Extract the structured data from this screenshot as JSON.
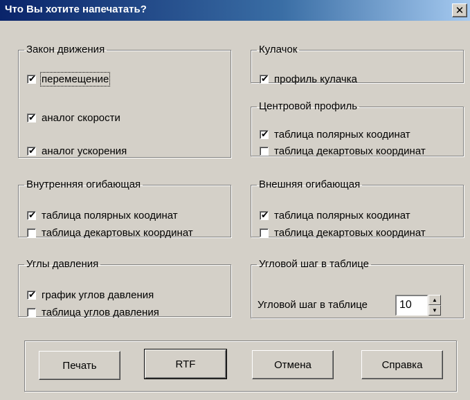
{
  "window": {
    "title": "Что Вы хотите напечатать?",
    "close_label": "✕"
  },
  "motion": {
    "legend": "Закон движения",
    "items": [
      {
        "label": "перемещение",
        "checked": true
      },
      {
        "label": "аналог скорости",
        "checked": true
      },
      {
        "label": "аналог ускорения",
        "checked": true
      }
    ]
  },
  "cam": {
    "legend": "Кулачок",
    "items": [
      {
        "label": "профиль кулачка",
        "checked": true
      }
    ]
  },
  "center_profile": {
    "legend": "Центровой профиль",
    "items": [
      {
        "label": "таблица полярных коодинат",
        "checked": true
      },
      {
        "label": "таблица декартовых координат",
        "checked": false
      }
    ]
  },
  "inner_envelope": {
    "legend": "Внутренняя огибающая",
    "items": [
      {
        "label": "таблица полярных коодинат",
        "checked": true
      },
      {
        "label": "таблица декартовых координат",
        "checked": false
      }
    ]
  },
  "outer_envelope": {
    "legend": "Внешняя огибающая",
    "items": [
      {
        "label": "таблица полярных коодинат",
        "checked": true
      },
      {
        "label": "таблица декартовых координат",
        "checked": false
      }
    ]
  },
  "pressure": {
    "legend": "Углы давления",
    "items": [
      {
        "label": "график углов давления",
        "checked": true
      },
      {
        "label": "таблица углов давления",
        "checked": false
      }
    ]
  },
  "angle_step": {
    "legend": "Угловой шаг в таблице",
    "label": "Угловой шаг в таблице",
    "value": "10"
  },
  "buttons": {
    "print": "Печать",
    "rtf": "RTF",
    "cancel": "Отмена",
    "help": "Справка"
  },
  "check_mark": "✔"
}
